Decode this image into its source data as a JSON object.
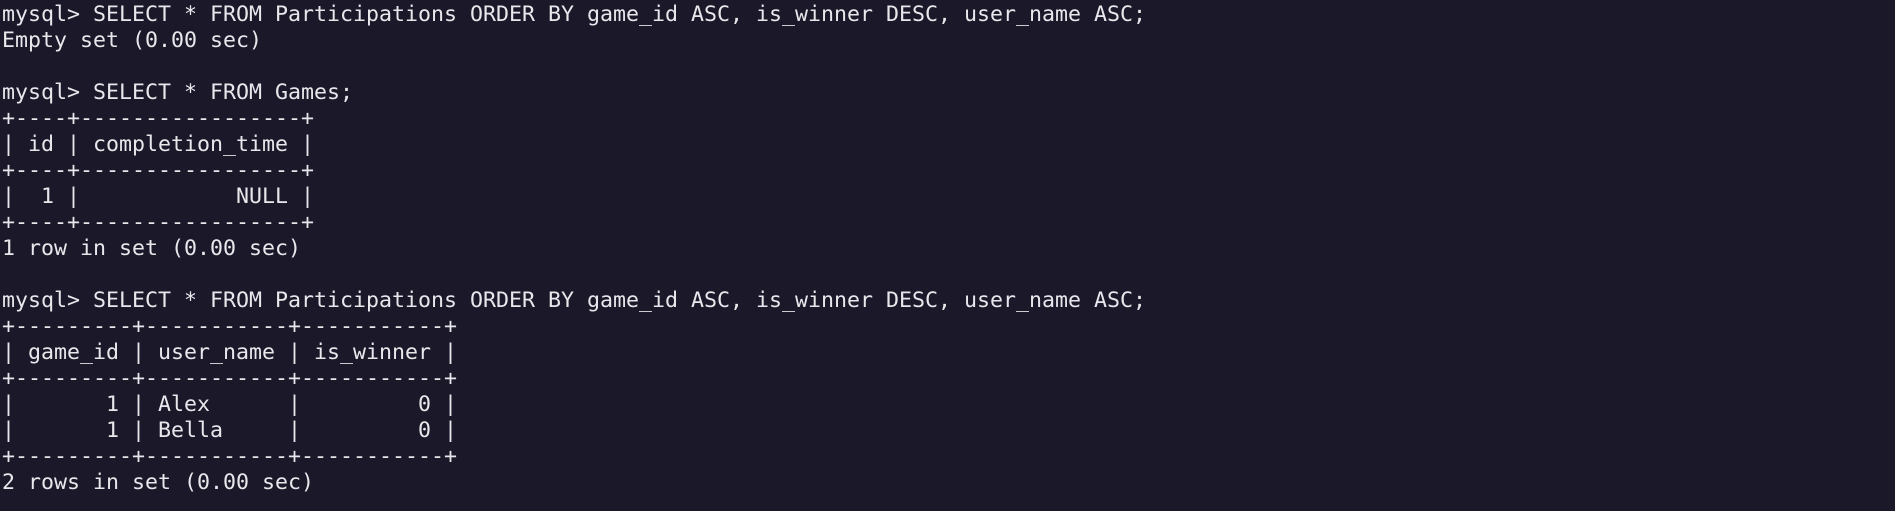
{
  "terminal": {
    "lines": [
      "mysql> SELECT * FROM Participations ORDER BY game_id ASC, is_winner DESC, user_name ASC;",
      "Empty set (0.00 sec)",
      "",
      "mysql> SELECT * FROM Games;",
      "+----+-----------------+",
      "| id | completion_time |",
      "+----+-----------------+",
      "|  1 |            NULL |",
      "+----+-----------------+",
      "1 row in set (0.00 sec)",
      "",
      "mysql> SELECT * FROM Participations ORDER BY game_id ASC, is_winner DESC, user_name ASC;",
      "+---------+-----------+-----------+",
      "| game_id | user_name | is_winner |",
      "+---------+-----------+-----------+",
      "|       1 | Alex      |         0 |",
      "|       1 | Bella     |         0 |",
      "+---------+-----------+-----------+",
      "2 rows in set (0.00 sec)"
    ]
  }
}
